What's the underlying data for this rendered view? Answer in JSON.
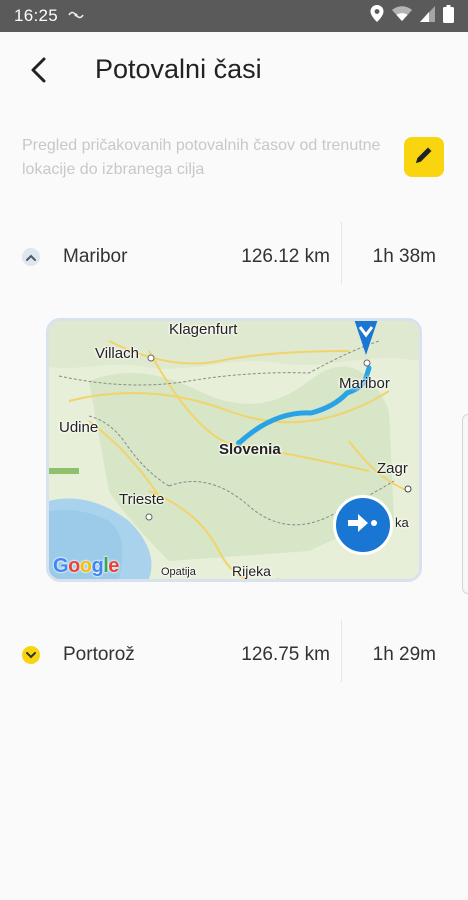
{
  "status": {
    "time": "16:25",
    "nfc_icon": "nfc-icon",
    "icons": [
      "location-icon",
      "wifi-icon",
      "signal-icon",
      "battery-icon"
    ]
  },
  "header": {
    "title": "Potovalni časi",
    "back_icon": "back-arrow-icon"
  },
  "description": "Pregled pričakovanih potovalnih časov od trenutne lokacije do izbranega cilja",
  "edit_icon": "pencil-icon",
  "colors": {
    "accent": "#f9d50f",
    "route": "#29a3e6",
    "nav_button": "#1976d2",
    "description_text": "#c8c8c8"
  },
  "destinations": [
    {
      "name": "Maribor",
      "distance": "126.12 km",
      "time": "1h 38m",
      "expanded": true,
      "chevron": "chevron-up-icon"
    },
    {
      "name": "Portorož",
      "distance": "126.75 km",
      "time": "1h 29m",
      "expanded": false,
      "chevron": "chevron-down-icon"
    }
  ],
  "map": {
    "labels": {
      "klagenfurt": "Klagenfurt",
      "villach": "Villach",
      "maribor": "Maribor",
      "udine": "Udine",
      "slovenia": "Slovenia",
      "zagreb": "Zagr",
      "trieste": "Trieste",
      "rijeka": "Rijeka",
      "opatija": "Opatija",
      "zagreb_tail": "ka"
    },
    "logo": "Google",
    "navigate_icon": "navigate-arrow-icon",
    "pin_icon": "map-pin-icon"
  }
}
